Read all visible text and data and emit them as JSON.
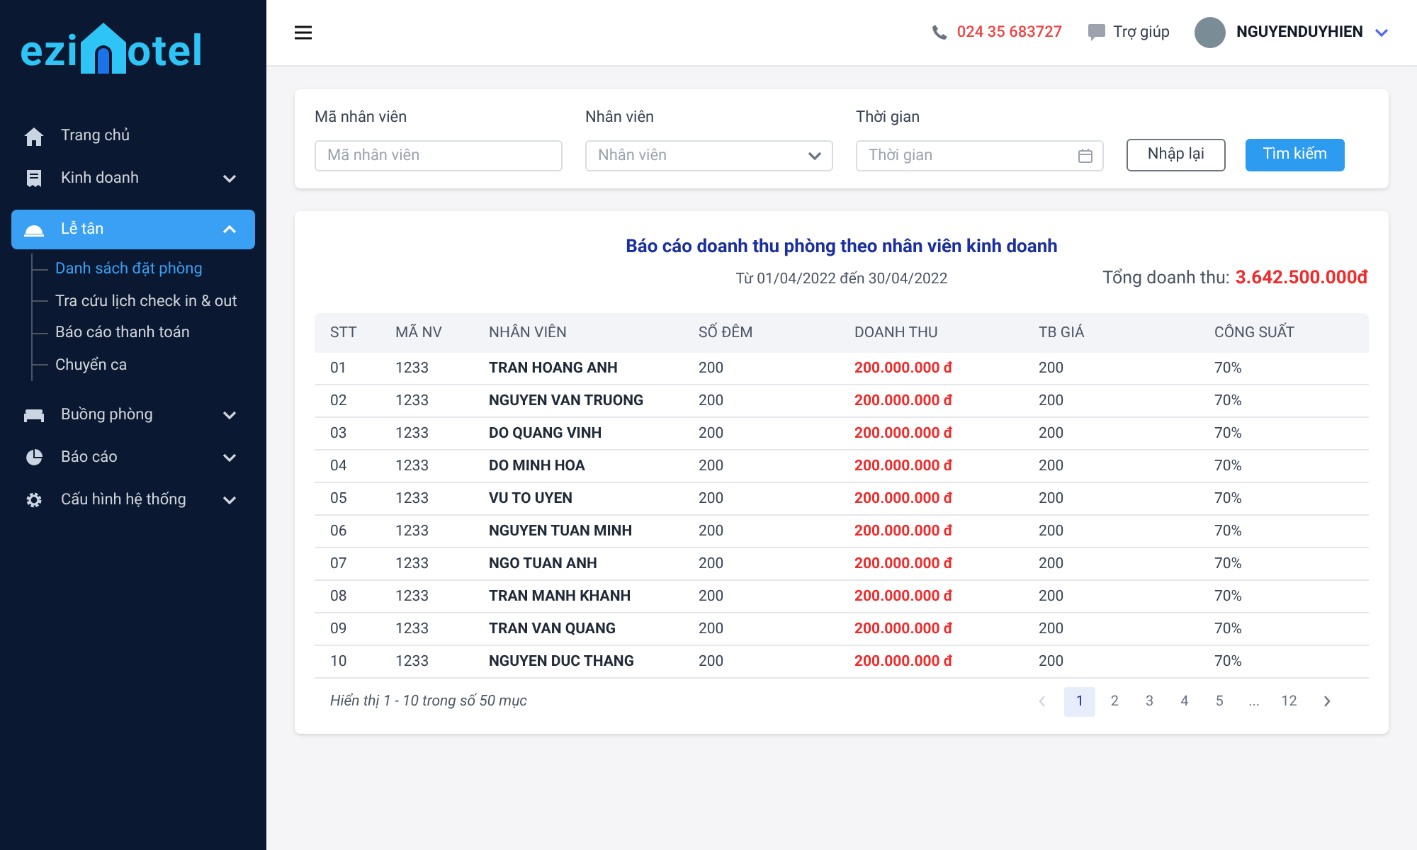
{
  "logo": {
    "left": "ezi",
    "right": "otel"
  },
  "sidebar": {
    "items": [
      {
        "label": "Trang chủ",
        "selected": false
      },
      {
        "label": "Kinh doanh",
        "expanded": false,
        "selected": false
      },
      {
        "label": "Lễ tân",
        "expanded": true,
        "selected": true,
        "children": [
          {
            "label": "Danh sách đặt phòng",
            "selected": true
          },
          {
            "label": "Tra cứu lịch check in & out",
            "selected": false
          },
          {
            "label": "Báo cáo thanh toán",
            "selected": false
          },
          {
            "label": "Chuyển ca",
            "selected": false
          }
        ]
      },
      {
        "label": "Buồng phòng",
        "expanded": false,
        "selected": false
      },
      {
        "label": "Báo cáo",
        "expanded": false,
        "selected": false
      },
      {
        "label": "Cấu hình hệ thống",
        "expanded": false,
        "selected": false
      }
    ]
  },
  "header": {
    "phone": "024 35 683727",
    "help": "Trợ giúp",
    "user": "NGUYENDUYHIEN"
  },
  "filters": {
    "fields": [
      {
        "kind": "text",
        "label": "Mã nhân viên",
        "placeholder": "Mã nhân viên"
      },
      {
        "kind": "select",
        "label": "Nhân viên",
        "placeholder": "Nhân viên"
      },
      {
        "kind": "date",
        "label": "Thời gian",
        "placeholder": "Thời gian"
      }
    ],
    "buttons": [
      {
        "kind": "outline",
        "label": "Nhập lại"
      },
      {
        "kind": "primary",
        "label": "Tìm kiếm"
      }
    ]
  },
  "report": {
    "title": "Báo cáo doanh thu phòng theo nhân viên kinh doanh",
    "period": "Từ 01/04/2022 đến 30/04/2022",
    "total_label": "Tổng doanh thu:",
    "total_value": "3.642.500.000đ"
  },
  "table": {
    "columns": [
      "STT",
      "MÃ NV",
      "NHÂN VIÊN",
      "SỐ ĐÊM",
      "DOANH THU",
      "TB GIÁ",
      "CÔNG SUẤT"
    ],
    "rows": [
      [
        "01",
        "1233",
        "TRAN HOANG ANH",
        "200",
        "200.000.000 đ",
        "200",
        "70%"
      ],
      [
        "02",
        "1233",
        "NGUYEN VAN TRUONG",
        "200",
        "200.000.000 đ",
        "200",
        "70%"
      ],
      [
        "03",
        "1233",
        "DO QUANG VINH",
        "200",
        "200.000.000 đ",
        "200",
        "70%"
      ],
      [
        "04",
        "1233",
        "DO MINH HOA",
        "200",
        "200.000.000 đ",
        "200",
        "70%"
      ],
      [
        "05",
        "1233",
        "VU TO UYEN",
        "200",
        "200.000.000 đ",
        "200",
        "70%"
      ],
      [
        "06",
        "1233",
        "NGUYEN TUAN MINH",
        "200",
        "200.000.000 đ",
        "200",
        "70%"
      ],
      [
        "07",
        "1233",
        "NGO TUAN ANH",
        "200",
        "200.000.000 đ",
        "200",
        "70%"
      ],
      [
        "08",
        "1233",
        "TRAN MANH KHANH",
        "200",
        "200.000.000 đ",
        "200",
        "70%"
      ],
      [
        "09",
        "1233",
        "TRAN VAN QUANG",
        "200",
        "200.000.000 đ",
        "200",
        "70%"
      ],
      [
        "10",
        "1233",
        "NGUYEN DUC THANG",
        "200",
        "200.000.000 đ",
        "200",
        "70%"
      ]
    ]
  },
  "footer": {
    "summary": "Hiển thị 1 - 10 trong số 50 mục",
    "pages": [
      {
        "label": "1",
        "selected": true
      },
      {
        "label": "2",
        "selected": false
      },
      {
        "label": "3",
        "selected": false
      },
      {
        "label": "4",
        "selected": false
      },
      {
        "label": "5",
        "selected": false
      },
      {
        "label": "...",
        "selected": false
      },
      {
        "label": "12",
        "selected": false
      }
    ],
    "prev_disabled": true
  }
}
